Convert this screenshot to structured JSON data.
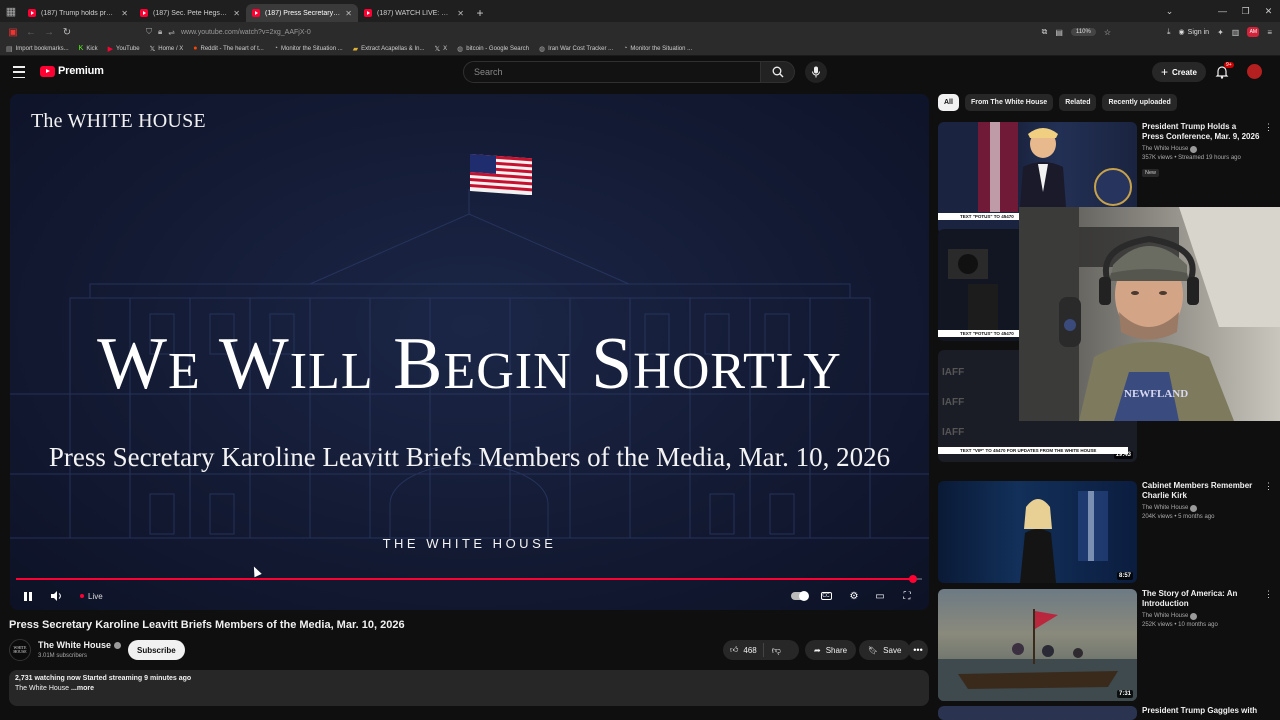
{
  "browser": {
    "tabs": [
      {
        "label": "(187) Trump holds press confer",
        "active": false
      },
      {
        "label": "(187) Sec. Pete Hegseth, Gen. D",
        "active": false
      },
      {
        "label": "(187) Press Secretary Karoline L",
        "active": true
      },
      {
        "label": "(187) WATCH LIVE: Karoline Lea",
        "active": false
      }
    ],
    "url": "www.youtube.com/watch?v=2xg_AAFjX-0",
    "zoom": "110%",
    "sign_in": "Sign in",
    "bookmarks": [
      {
        "label": "Import bookmarks...",
        "icon": "import-icon"
      },
      {
        "label": "Kick",
        "icon": "kick-icon"
      },
      {
        "label": "YouTube",
        "icon": "youtube-icon"
      },
      {
        "label": "Home / X",
        "icon": "x-icon"
      },
      {
        "label": "Reddit - The heart of t...",
        "icon": "reddit-icon"
      },
      {
        "label": "Monitor the Situation ...",
        "icon": "monitor-icon"
      },
      {
        "label": "Extract Acapellas & In...",
        "icon": "folder-icon"
      },
      {
        "label": "X",
        "icon": "x-icon"
      },
      {
        "label": "bitcoin - Google Search",
        "icon": "globe-icon"
      },
      {
        "label": "Iran War Cost Tracker ...",
        "icon": "globe-icon"
      },
      {
        "label": "Monitor the Situation ...",
        "icon": "monitor-icon"
      }
    ]
  },
  "youtube": {
    "logo_text": "Premium",
    "search_placeholder": "Search",
    "create_label": "Create",
    "notification_count": "9+"
  },
  "player": {
    "brand": "The WHITE HOUSE",
    "headline": "We Will Begin Shortly",
    "subtitle": "Press Secretary Karoline Leavitt Briefs Members of the Media, Mar. 10, 2026",
    "footer": "THE WHITE HOUSE",
    "live_label": "Live",
    "progress_fraction": 0.99
  },
  "video": {
    "title": "Press Secretary Karoline Leavitt Briefs Members of the Media, Mar. 10, 2026",
    "channel": "The White House",
    "subscribers": "3.01M subscribers",
    "subscribe_label": "Subscribe",
    "likes": "468",
    "share_label": "Share",
    "save_label": "Save",
    "watching": "2,731 watching now  Started streaming 9 minutes ago",
    "desc_text": "The White House ",
    "desc_more": "...more"
  },
  "sidebar": {
    "chips": [
      {
        "label": "All",
        "active": true
      },
      {
        "label": "From The White House",
        "active": false
      },
      {
        "label": "Related",
        "active": false
      },
      {
        "label": "Recently uploaded",
        "active": false
      }
    ],
    "recommendations": [
      {
        "title": "President Trump Holds a Press Conference, Mar. 9, 2026",
        "channel": "The White House",
        "stats": "357K views • Streamed 19 hours ago",
        "badge": "New",
        "duration": ""
      },
      {
        "title": "",
        "channel": "",
        "stats": "",
        "badge": "",
        "duration": ""
      },
      {
        "title": "",
        "channel": "",
        "stats": "",
        "badge": "",
        "duration": "19:43"
      },
      {
        "title": "Cabinet Members Remember Charlie Kirk",
        "channel": "The White House",
        "stats": "204K views • 5 months ago",
        "badge": "",
        "duration": "8:57"
      },
      {
        "title": "The Story of America: An Introduction",
        "channel": "The White House",
        "stats": "252K views • 10 months ago",
        "badge": "",
        "duration": "7:31"
      },
      {
        "title": "President Trump Gaggles with",
        "channel": "",
        "stats": "",
        "badge": "",
        "duration": ""
      }
    ],
    "tickers": [
      "TEXT \"POTUS\" TO 45470",
      "TEXT \"POTUS\" TO 45470",
      "TEXT \"VIP\" TO 45470 FOR UPDATES FROM THE WHITE HOUSE"
    ]
  },
  "colors": {
    "accent": "#ff0033",
    "background": "#0f0f0f",
    "player_bg": "#131a33"
  }
}
